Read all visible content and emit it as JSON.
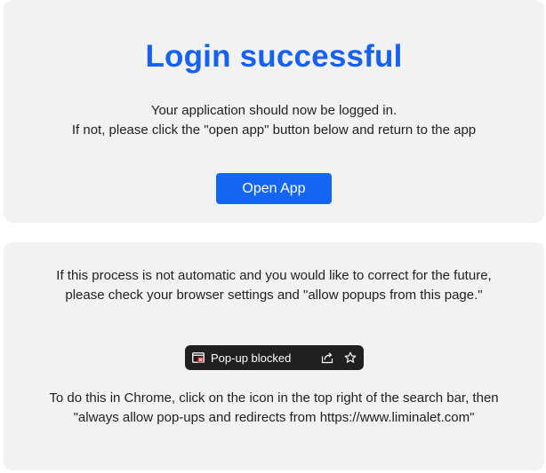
{
  "success": {
    "title": "Login successful",
    "message_line1": "Your application should now be logged in.",
    "message_line2": "If not, please click the \"open app\" button below and return to the app",
    "open_button": "Open App"
  },
  "instructions": {
    "paragraph1": "If this process is not automatic and you would like to correct for the future, please check your browser settings and \"allow popups from this page.\"",
    "popup_bar": {
      "label": "Pop-up blocked",
      "icons": [
        "popup-blocked-icon",
        "share-icon",
        "star-icon"
      ]
    },
    "paragraph2": "To do this in Chrome, click on the icon in the top right of the search bar, then \"always allow pop-ups and redirects from https://www.liminalet.com\""
  },
  "colors": {
    "accent": "#1565f5",
    "card_bg": "#f2f2f2",
    "popup_bg": "#202020",
    "blocked_red": "#e5322d"
  }
}
